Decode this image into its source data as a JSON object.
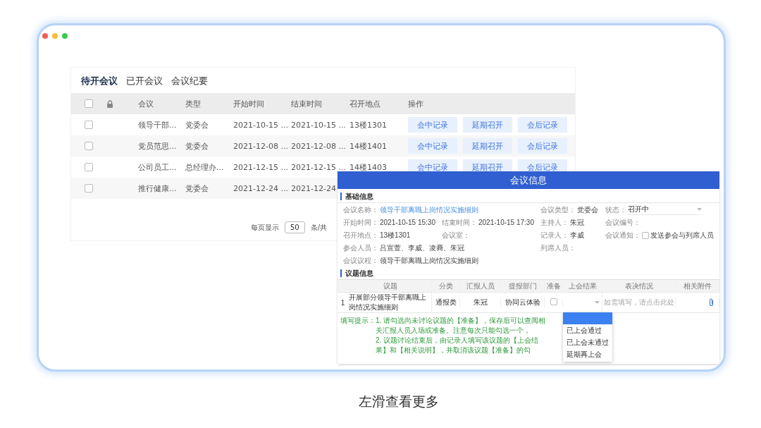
{
  "tabs": [
    {
      "label": "待开会议",
      "selected": true
    },
    {
      "label": "已开会议",
      "selected": false
    },
    {
      "label": "会议纪要",
      "selected": false
    }
  ],
  "table": {
    "header_checked": false,
    "columns": [
      "会议",
      "类型",
      "开始时间",
      "结束时间",
      "召开地点",
      "操作"
    ],
    "rows": [
      {
        "checked": false,
        "cells": [
          "领导干部...",
          "党委会",
          "2021-10-15 ...",
          "2021-10-15 ...",
          "13楼1301"
        ],
        "actions": [
          "会中记录",
          "延期召开",
          "会后记录"
        ]
      },
      {
        "checked": false,
        "cells": [
          "党员范思...",
          "党委会",
          "2021-12-08 ...",
          "2021-12-08 ...",
          "14楼1401"
        ],
        "actions": [
          "会中记录",
          "延期召开",
          "会后记录"
        ]
      },
      {
        "checked": false,
        "cells": [
          "公司员工...",
          "总经理办...",
          "2021-12-15 ...",
          "2021-12-15 ...",
          "14楼1403"
        ],
        "actions": [
          "会中记录",
          "延期召开",
          "会后记录"
        ]
      },
      {
        "checked": false,
        "cells": [
          "推行健康...",
          "党委会",
          "2021-12-24 ...",
          "2021-12-24"
        ],
        "actions": []
      }
    ]
  },
  "pager": {
    "label": "每页显示",
    "page_size": "50",
    "suffix": "条/共"
  },
  "dialog": {
    "title": "会议信息",
    "basic_section": "基础信息",
    "field_rows": [
      [
        {
          "kind": "link",
          "label": "会议名称：",
          "value": "领导干部离職上岗情况实施细则"
        },
        {
          "kind": "text",
          "label": "会议类型：",
          "value": "党委会"
        },
        {
          "kind": "select",
          "label": "状态：",
          "value": "召开中"
        }
      ],
      [
        {
          "kind": "text",
          "label": "开始时间：",
          "value": "2021-10-15 15:30"
        },
        {
          "kind": "text",
          "label": "结束时间：",
          "value": "2021-10-15 17:30"
        },
        {
          "kind": "text",
          "label": "主持人：",
          "value": "朱冠"
        },
        {
          "kind": "text",
          "label": "会议编号："
        }
      ],
      [
        {
          "kind": "text",
          "label": "召开地点：",
          "value": "13楼1301"
        },
        {
          "kind": "text",
          "label": "会议室："
        },
        {
          "kind": "text",
          "label": "记录人：",
          "value": "李威"
        },
        {
          "kind": "checkbox",
          "label": "会议通知：",
          "value": "发送参会与列席人员",
          "checked": false
        }
      ],
      [
        {
          "kind": "text",
          "label": "参会人员：",
          "value": "吕宣萱、李威、凌裔、朱冠"
        },
        {
          "kind": "text",
          "label": "列席人员："
        }
      ],
      [
        {
          "kind": "text",
          "label": "会议议程：",
          "value": "领导干部离職上岗情况实施细则"
        }
      ]
    ],
    "topic_section": "议题信息",
    "topic_columns": [
      "议题",
      "分类",
      "汇报人员",
      "提报部门",
      "准备",
      "上会结果",
      "表决情况",
      "相关附件"
    ],
    "topics": [
      {
        "index": "1",
        "title": "开展部分领导干部离職上岗情况实施细则",
        "category": "通报类",
        "reporter": "朱冠",
        "department": "协同云体验",
        "ready": false,
        "vote_placeholder": "如需填写，请点击此处"
      }
    ],
    "hint_label": "填写提示：",
    "hints": [
      "1. 请勾选尚未讨论议题的【准备】，保存后可以查阅相关汇报人员入场或准备。注意每次只能勾选一个，",
      "2. 议题讨论结束后，由记录人填写该议题的【上会结果】和【相关说明】，并取消该议题【准备】的勾"
    ],
    "result_options": [
      {
        "selected": true
      },
      {
        "label": "已上会通过",
        "selected": false
      },
      {
        "label": "已上会未通过",
        "selected": false
      },
      {
        "label": "延期再上会",
        "selected": false
      }
    ]
  },
  "caption": "左滑查看更多"
}
